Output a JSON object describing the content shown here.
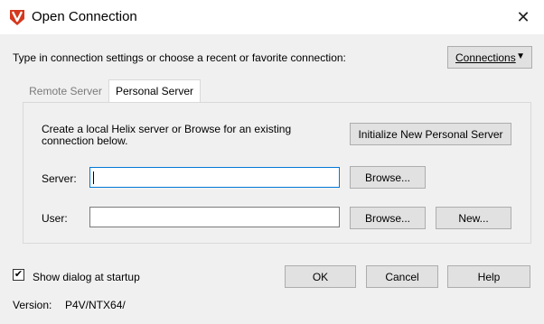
{
  "window": {
    "title": "Open Connection",
    "close_glyph": "✕",
    "app_icon": "p4v-logo-icon",
    "accent_color": "#0078d7",
    "logo_color": "#d4391e"
  },
  "header": {
    "instructions": "Type in connection settings or choose a recent or favorite connection:",
    "connections_button": "Connections",
    "connections_arrow": "▼"
  },
  "tabs": [
    {
      "label": "Remote Server",
      "active": false
    },
    {
      "label": "Personal Server",
      "active": true
    }
  ],
  "personal_server": {
    "description": "Create a local Helix server or Browse for an existing connection below.",
    "initialize_button": "Initialize New Personal Server",
    "server_label": "Server:",
    "server_value": "",
    "server_browse_button": "Browse...",
    "user_label": "User:",
    "user_value": "",
    "user_browse_button": "Browse...",
    "user_new_button": "New..."
  },
  "footer": {
    "show_dialog_checked": true,
    "show_dialog_label": "Show dialog at startup",
    "check_glyph": "✔",
    "ok_button": "OK",
    "cancel_button": "Cancel",
    "help_button": "Help",
    "version_label": "Version:",
    "version_value": "P4V/NTX64/"
  }
}
